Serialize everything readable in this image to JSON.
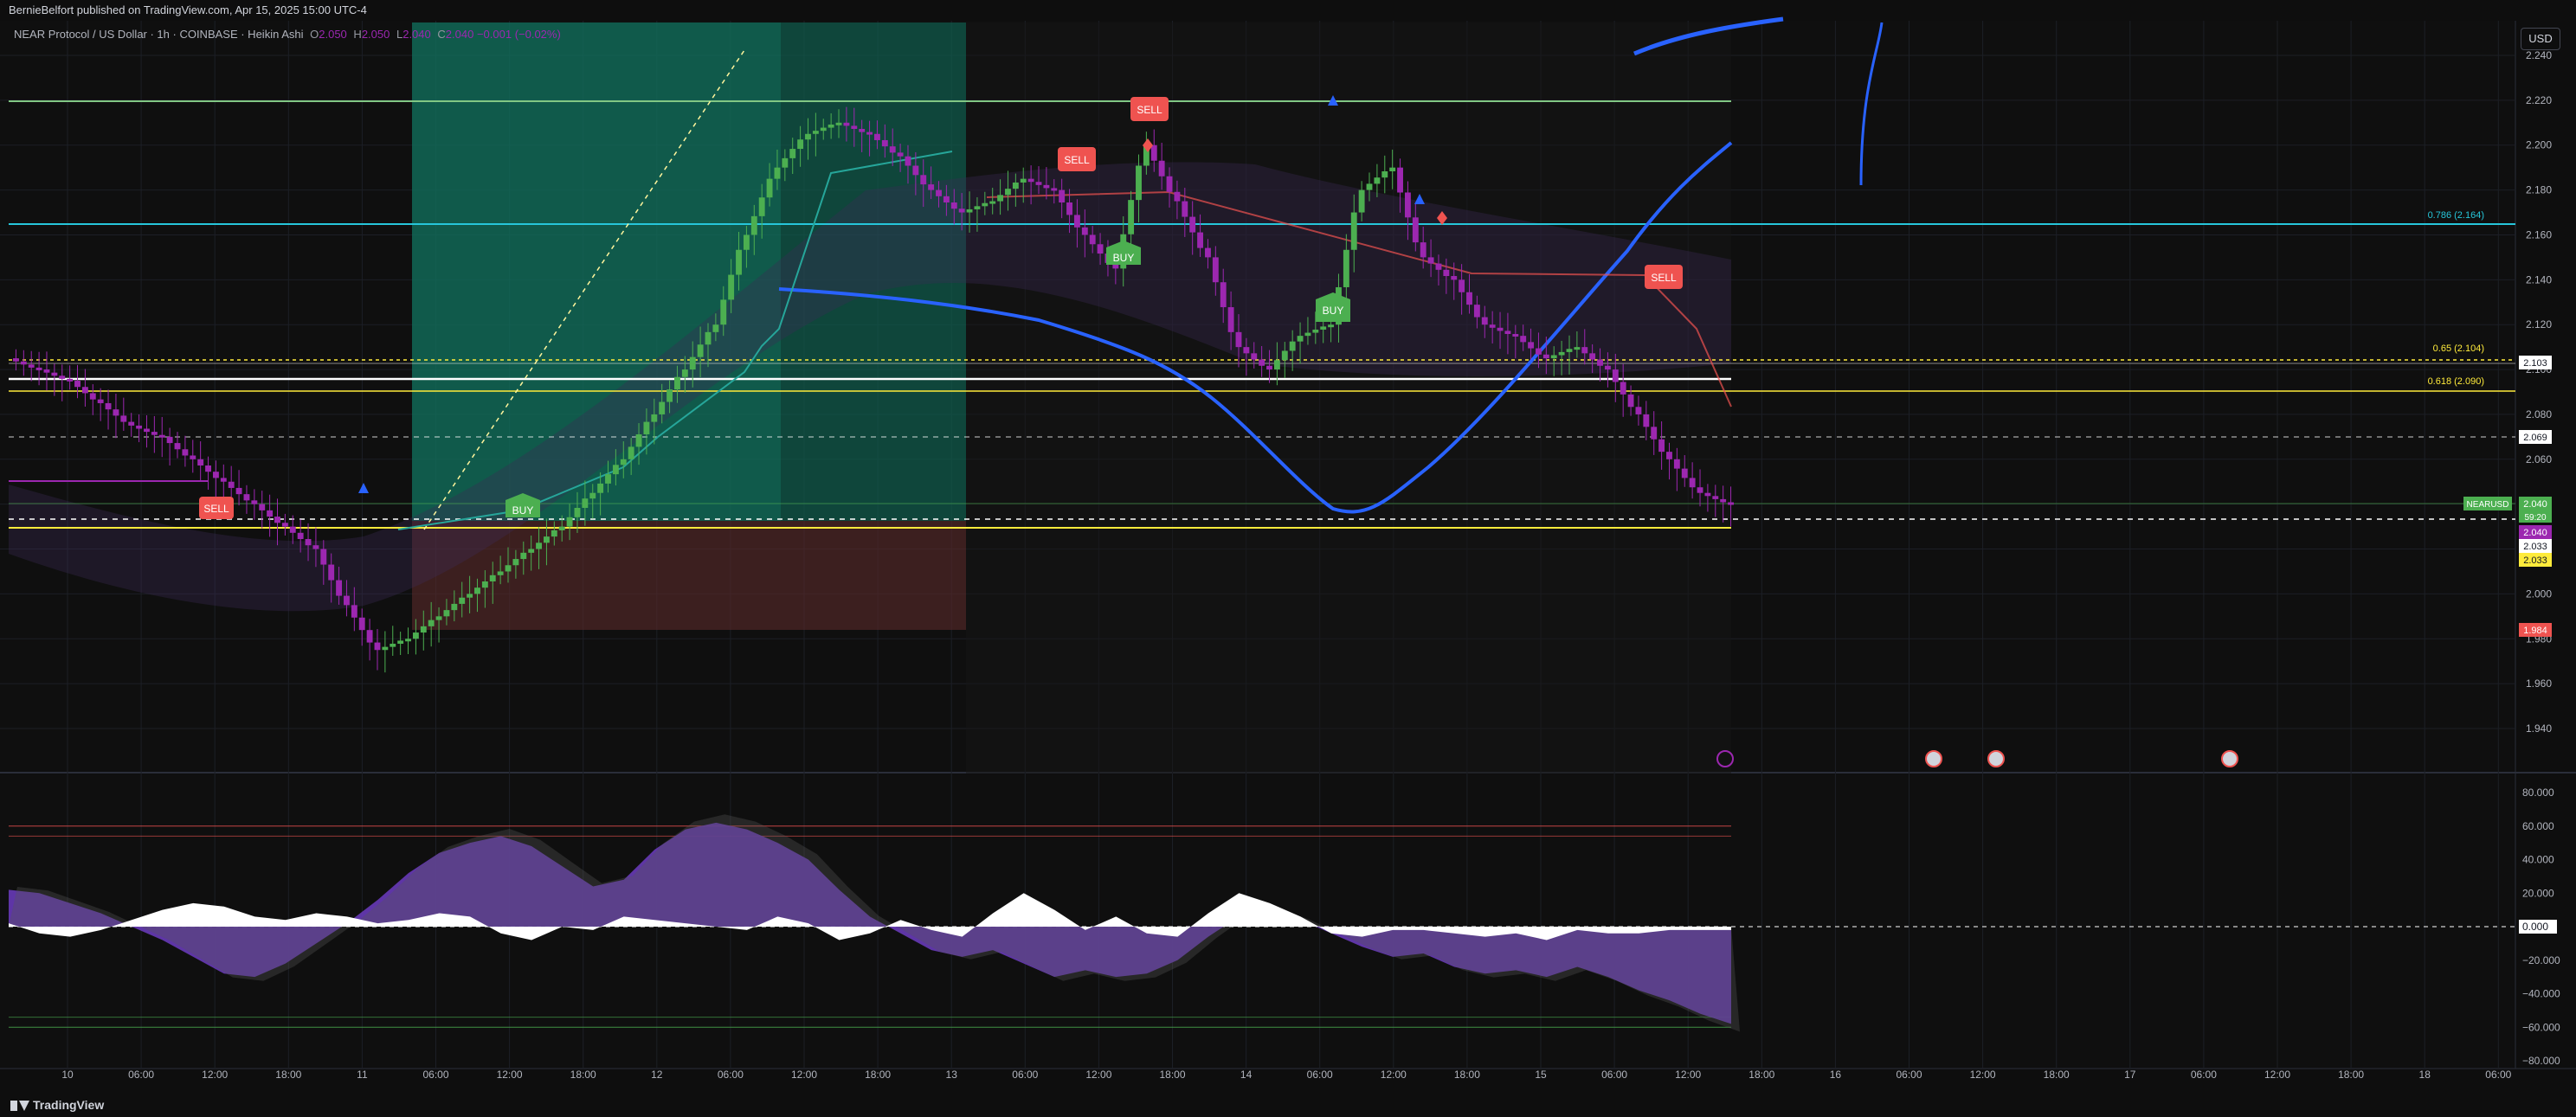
{
  "header": {
    "published": "BernieBelfort published on TradingView.com, Apr 15, 2025 15:00 UTC-4"
  },
  "legend": {
    "symbol": "NEAR Protocol / US Dollar · 1h · COINBASE · Heikin Ashi",
    "o_label": "O",
    "o_value": "2.050",
    "h_label": "H",
    "h_value": "2.050",
    "l_label": "L",
    "l_value": "2.040",
    "c_label": "C",
    "c_value": "2.040",
    "change": "−0.001 (−0.02%)"
  },
  "currency_button": "USD",
  "price_axis": {
    "ticks": [
      "2.240",
      "2.220",
      "2.200",
      "2.180",
      "2.160",
      "2.140",
      "2.120",
      "2.100",
      "2.080",
      "2.060",
      "2.040",
      "2.020",
      "2.000",
      "1.980",
      "1.960",
      "1.940"
    ]
  },
  "price_labels": {
    "fib_786": "0.786 (2.164)",
    "fib_65": "0.65 (2.104)",
    "fib_618": "0.618 (2.090)",
    "line_2103": "2.103",
    "line_2069": "2.069",
    "symbol_tag": "NEARUSD",
    "last_price": "2.040",
    "countdown": "59:20",
    "tag_2040b": "2.040",
    "tag_2033a": "2.033",
    "tag_2033b": "2.033",
    "tag_1984": "1.984"
  },
  "signals": {
    "sell": "SELL",
    "buy": "BUY",
    "sell_left": "SELL"
  },
  "osc_axis": {
    "ticks": [
      "80.000",
      "60.000",
      "40.000",
      "20.000",
      "0.000",
      "−20.000",
      "−40.000",
      "−60.000",
      "−80.000"
    ]
  },
  "time_axis": {
    "ticks": [
      "10",
      "06:00",
      "12:00",
      "18:00",
      "11",
      "06:00",
      "12:00",
      "18:00",
      "12",
      "06:00",
      "12:00",
      "18:00",
      "13",
      "06:00",
      "12:00",
      "18:00",
      "14",
      "06:00",
      "12:00",
      "18:00",
      "15",
      "06:00",
      "12:00",
      "18:00",
      "16",
      "06:00",
      "12:00",
      "18:00",
      "17",
      "06:00",
      "12:00",
      "18:00",
      "18",
      "06:00"
    ]
  },
  "footer": {
    "brand": "TradingView"
  },
  "colors": {
    "bull": "#4caf50",
    "bear": "#9c27b0",
    "ma": "#2962ff",
    "fib_cyan": "#26c6da",
    "fib_yellow": "#ffeb3b",
    "sell": "#ef5350",
    "buy": "#4caf50",
    "osc": "#673ab7"
  },
  "chart_data": {
    "type": "candlestick",
    "title": "NEAR Protocol / US Dollar · 1h · COINBASE · Heikin Ashi",
    "ylim": [
      1.92,
      2.245
    ],
    "candles_close_approx": [
      2.1,
      2.095,
      2.085,
      2.075,
      2.07,
      2.06,
      2.05,
      2.04,
      2.03,
      2.02,
      1.995,
      1.975,
      1.98,
      1.99,
      2.0,
      2.01,
      2.02,
      2.03,
      2.045,
      2.06,
      2.08,
      2.1,
      2.12,
      2.16,
      2.19,
      2.205,
      2.21,
      2.205,
      2.195,
      2.18,
      2.17,
      2.175,
      2.185,
      2.18,
      2.16,
      2.145,
      2.2,
      2.175,
      2.15,
      2.11,
      2.1,
      2.115,
      2.12,
      2.18,
      2.19,
      2.15,
      2.14,
      2.12,
      2.115,
      2.105,
      2.11,
      2.1,
      2.08,
      2.06,
      2.045,
      2.04
    ],
    "oscillator_ylim": [
      -80,
      80
    ]
  }
}
